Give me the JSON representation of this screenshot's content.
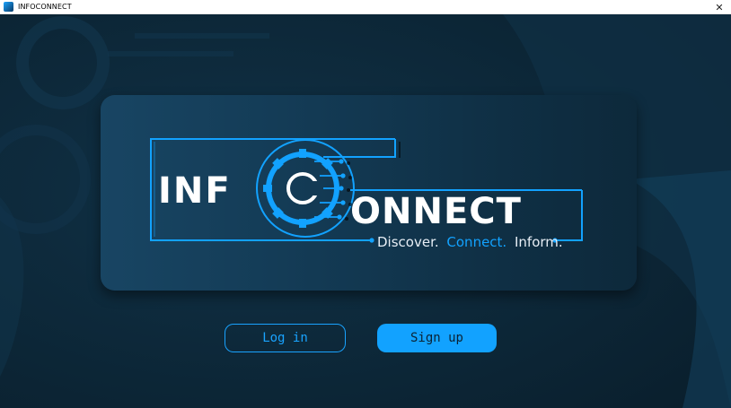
{
  "window": {
    "title": "INFOCONNECT",
    "close_glyph": "✕",
    "icon": "app-icon"
  },
  "logo": {
    "word1": "INF",
    "word2": "ONNECT",
    "tagline_part1": "Discover.",
    "tagline_part2": "Connect.",
    "tagline_part3": "Inform.",
    "emblem_icon": "gear-icon",
    "colors": {
      "accent": "#12a2ff",
      "text": "#ffffff",
      "background": "#0d2434"
    }
  },
  "actions": {
    "login_label": "Log in",
    "signup_label": "Sign up"
  }
}
